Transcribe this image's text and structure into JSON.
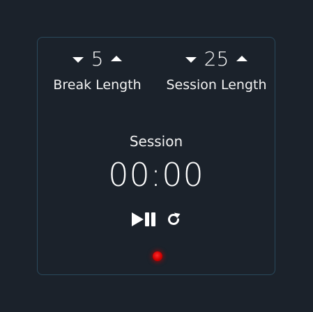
{
  "break": {
    "value": "5",
    "label": "Break Length",
    "decrement_icon": "caret-down-icon",
    "increment_icon": "caret-up-icon"
  },
  "session": {
    "value": "25",
    "label": "Session Length",
    "decrement_icon": "caret-down-icon",
    "increment_icon": "caret-up-icon"
  },
  "timer": {
    "label": "Session",
    "time_left": "00:00"
  },
  "controls": {
    "play_pause_icon": "play-pause-icon",
    "reset_icon": "refresh-icon"
  },
  "indicator": {
    "color": "#d00000"
  },
  "colors": {
    "background": "#1b222b",
    "card_border": "#2a4a5c",
    "text": "#ffffff"
  }
}
